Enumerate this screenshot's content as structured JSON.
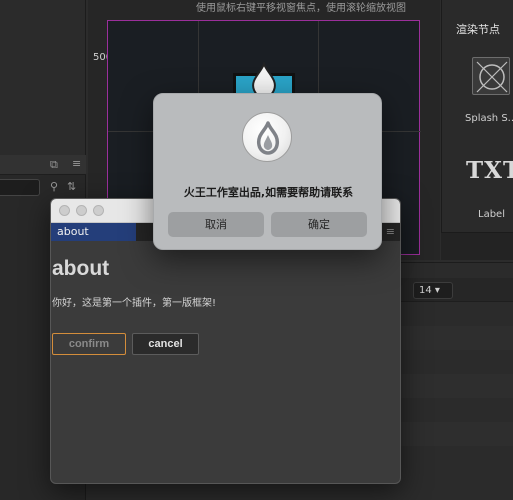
{
  "scene": {
    "hint": "使用鼠标右键平移视窗焦点，使用滚轮缩放视图",
    "ruler_value": "500"
  },
  "right_panel": {
    "title": "渲染节点",
    "items": [
      {
        "label": "Splash S...",
        "icon": "splash-sprite-icon"
      },
      {
        "label": "Label",
        "glyph": "TXT"
      }
    ]
  },
  "bottom_panel": {
    "zoom_value": "14 ▾"
  },
  "about_window": {
    "tab_label": "about",
    "heading": "about",
    "text": "你好，这是第一个插件，第一版框架!",
    "confirm_label": "confirm",
    "cancel_label": "cancel",
    "colors": {
      "tab": "#243e7a",
      "confirm_border": "#d48d3b"
    }
  },
  "alert": {
    "icon": "cocos-flame-icon",
    "message": "火王工作室出品,如需要帮助请联系",
    "cancel_label": "取消",
    "ok_label": "确定"
  }
}
